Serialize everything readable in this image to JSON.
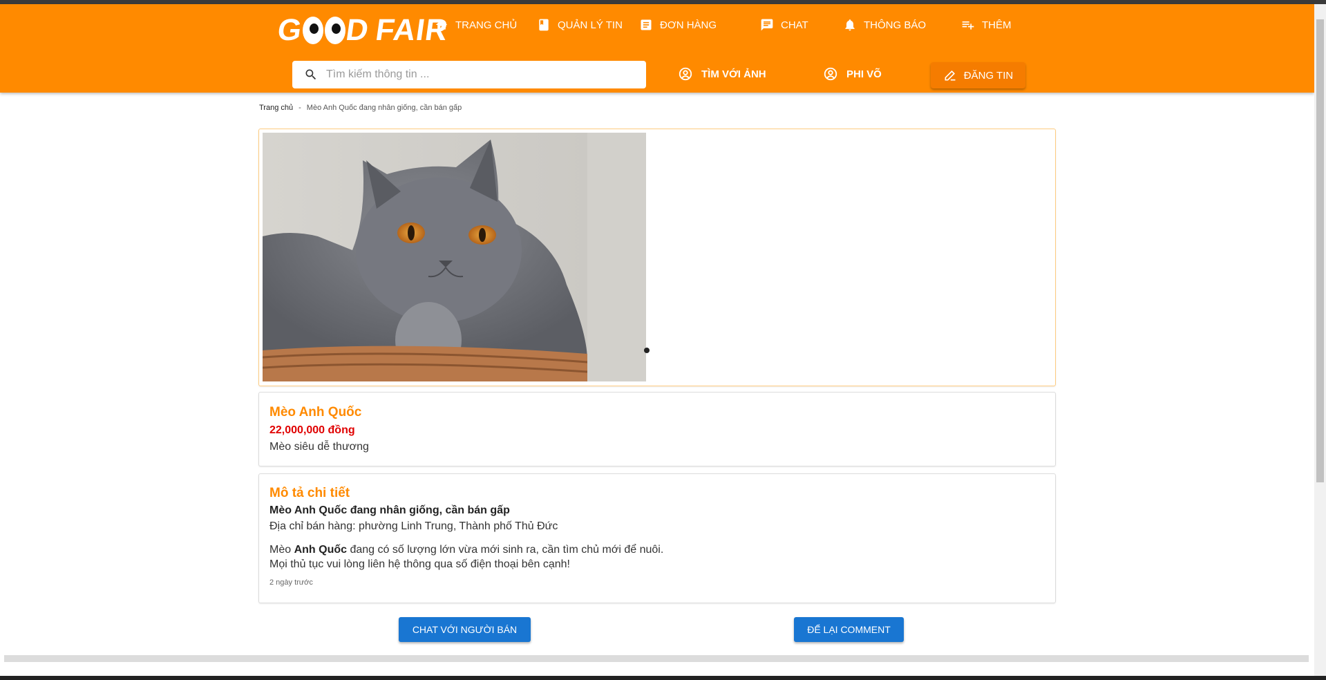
{
  "brand": {
    "logo_start": "G",
    "logo_end": "D",
    "logo_word": "FAIR"
  },
  "nav": {
    "home": "TRANG CHỦ",
    "manage": "QUẢN LÝ TIN",
    "orders": "ĐƠN HÀNG",
    "chat": "CHAT",
    "notifications": "THÔNG BÁO",
    "more": "THÊM"
  },
  "search": {
    "placeholder": "Tìm kiếm thông tin ..."
  },
  "nav2": {
    "image_search": "TÌM VỚI ẢNH",
    "user": "PHI VÕ",
    "post": "ĐĂNG TIN"
  },
  "breadcrumb": {
    "home": "Trang chủ",
    "sep": "-",
    "current": "Mèo Anh Quốc đang nhân giống, cần bán gấp"
  },
  "listing": {
    "title": "Mèo Anh Quốc",
    "price": "22,000,000 đồng",
    "short_desc": "Mèo siêu dễ thương"
  },
  "details": {
    "title": "Mô tả chi tiết",
    "headline": "Mèo Anh Quốc đang nhân giống, cần bán gấp",
    "address": "Địa chỉ bán hàng: phường Linh Trung, Thành phố Thủ Đức",
    "body_prefix": "Mèo ",
    "body_bold": "Anh Quốc",
    "body_suffix": " đang có số lượng lớn vừa mới sinh ra, cần tìm chủ mới để nuôi.",
    "body_line2": "Mọi thủ tục vui lòng liên hệ thông qua số điện thoại bên cạnh!",
    "posted": "2 ngày trước"
  },
  "actions": {
    "chat_seller": "CHAT VỚI NGƯỜI BÁN",
    "comment": "ĐỂ LẠI COMMENT"
  },
  "colors": {
    "header": "#ff8a00",
    "title": "#ff8a00",
    "price": "#e00000",
    "button": "#1976d2"
  }
}
